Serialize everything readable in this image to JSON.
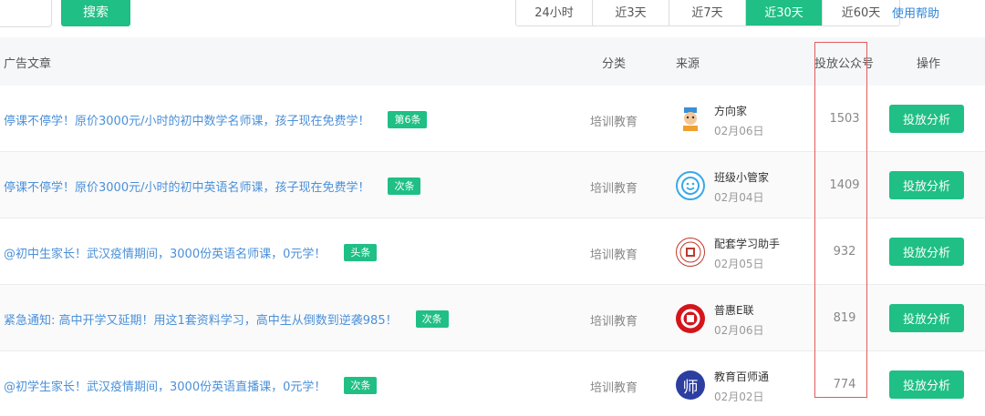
{
  "toolbar": {
    "search_label": "搜索",
    "ranges": [
      {
        "label": "24小时",
        "active": false
      },
      {
        "label": "近3天",
        "active": false
      },
      {
        "label": "近7天",
        "active": false
      },
      {
        "label": "近30天",
        "active": true
      },
      {
        "label": "近60天",
        "active": false
      }
    ],
    "help_label": "使用帮助"
  },
  "columns": {
    "article": "广告文章",
    "category": "分类",
    "source": "来源",
    "accounts": "投放公众号",
    "action": "操作"
  },
  "rows": [
    {
      "title": "停课不停学！原价3000元/小时的初中数学名师课，孩子现在免费学！",
      "tag": "第6条",
      "category": "培训教育",
      "source_name": "方向家",
      "source_date": "02月06日",
      "count": "1503",
      "action": "投放分析"
    },
    {
      "title": "停课不停学！原价3000元/小时的初中英语名师课，孩子现在免费学！",
      "tag": "次条",
      "category": "培训教育",
      "source_name": "班级小管家",
      "source_date": "02月04日",
      "count": "1409",
      "action": "投放分析"
    },
    {
      "title": "@初中生家长！武汉疫情期间，3000份英语名师课，0元学！",
      "tag": "头条",
      "category": "培训教育",
      "source_name": "配套学习助手",
      "source_date": "02月05日",
      "count": "932",
      "action": "投放分析"
    },
    {
      "title": "紧急通知: 高中开学又延期！用这1套资料学习，高中生从倒数到逆袭985！",
      "tag": "次条",
      "category": "培训教育",
      "source_name": "普惠E联",
      "source_date": "02月06日",
      "count": "819",
      "action": "投放分析"
    },
    {
      "title": "@初学生家长！武汉疫情期间，3000份英语直播课，0元学！",
      "tag": "次条",
      "category": "培训教育",
      "source_name": "教育百师通",
      "source_date": "02月02日",
      "count": "774",
      "action": "投放分析"
    }
  ],
  "avatars": {
    "row4_glyph": "师"
  },
  "colors": {
    "accent": "#1fbf85",
    "link": "#4a90d9",
    "highlight": "#e25b5b"
  }
}
